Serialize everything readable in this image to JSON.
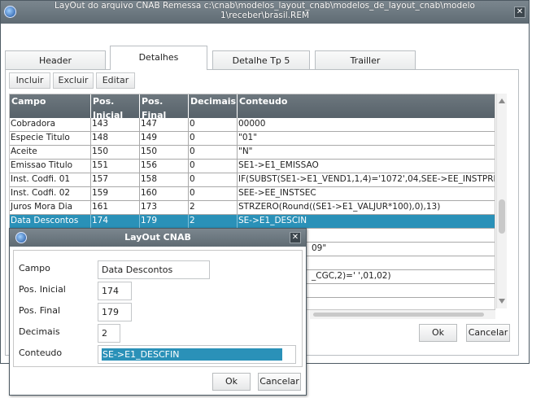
{
  "window": {
    "title": "LayOut do arquivo CNAB Remessa    c:\\cnab\\modelos_layout_cnab\\modelos_de_layout_cnab\\modelo 1\\receber\\brasil.REM"
  },
  "tabs": [
    {
      "label": "Header"
    },
    {
      "label": "Detalhes"
    },
    {
      "label": "Detalhe Tp 5"
    },
    {
      "label": "Trailler"
    }
  ],
  "toolbar": {
    "incluir_label": "Incluir",
    "excluir_label": "Excluir",
    "editar_label": "Editar"
  },
  "grid": {
    "columns": [
      "Campo",
      "Pos. Inicial",
      "Pos. Final",
      "Decimais",
      "Conteudo"
    ],
    "rows": [
      [
        "Cobradora",
        "143",
        "147",
        "0",
        "00000"
      ],
      [
        "Especie Titulo",
        "148",
        "149",
        "0",
        "\"01\""
      ],
      [
        "Aceite",
        "150",
        "150",
        "0",
        "\"N\""
      ],
      [
        "Emissao Titulo",
        "151",
        "156",
        "0",
        "SE1->E1_EMISSAO"
      ],
      [
        "Inst. Codfi. 01",
        "157",
        "158",
        "0",
        "IF(SUBST(SE1->E1_VEND1,1,4)='1072',04,SEE->EE_INSTPRI)"
      ],
      [
        "Inst. Codfi. 02",
        "159",
        "160",
        "0",
        "SEE->EE_INSTSEC"
      ],
      [
        "Juros Mora Dia",
        "161",
        "173",
        "2",
        "STRZERO(Round((SE1->E1_VALJUR*100),0),13)"
      ],
      [
        "Data Descontos",
        "174",
        "179",
        "2",
        "SE->E1_DESCIN"
      ]
    ],
    "partial_visible": {
      "row_a": "09\"",
      "row_b": "_CGC,2)='  ',01,02)"
    }
  },
  "main_buttons": {
    "ok_label": "Ok",
    "cancel_label": "Cancelar"
  },
  "dialog": {
    "title": "LayOut CNAB",
    "fields": {
      "campo_label": "Campo",
      "campo_value": "Data Descontos",
      "pos_inicial_label": "Pos. Inicial",
      "pos_inicial_value": "174",
      "pos_final_label": "Pos. Final",
      "pos_final_value": "179",
      "decimais_label": "Decimais",
      "decimais_value": "2",
      "conteudo_label": "Conteudo",
      "conteudo_value": "SE->E1_DESCFIN"
    },
    "ok_label": "Ok",
    "cancel_label": "Cancelar"
  },
  "colors": {
    "selection": "#2a91b8",
    "titlebar": "#66727a",
    "grid_header": "#5f6a72"
  }
}
